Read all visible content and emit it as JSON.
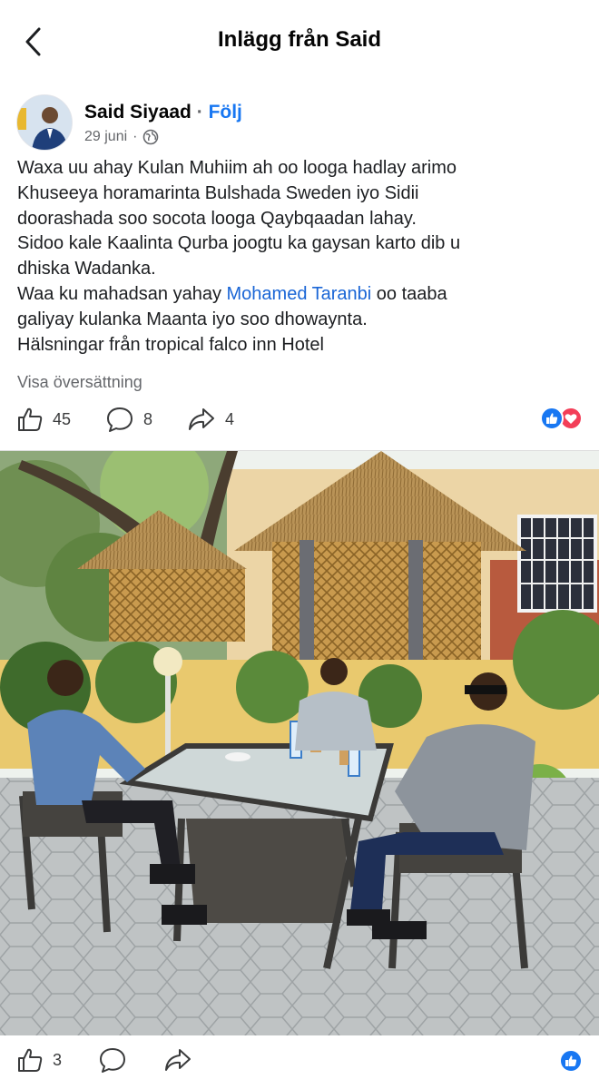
{
  "header": {
    "title": "Inlägg från Said"
  },
  "author": {
    "name": "Said Siyaad",
    "separator": " · ",
    "follow_label": "Följ",
    "date": "29 juni",
    "date_separator": "·"
  },
  "post": {
    "lines": [
      "Waxa uu ahay Kulan Muhiim ah oo looga hadlay arimo",
      "Khuseeya horamarinta Bulshada Sweden iyo Sidii",
      "doorashada soo socota looga Qaybqaadan lahay.",
      "Sidoo kale Kaalinta Qurba joogtu ka gaysan karto dib u",
      "dhiska Wadanka."
    ],
    "line6_before": "Waa ku mahadsan yahay ",
    "mention": "Mohamed Taranbi",
    "line6_after": " oo taaba",
    "lines_end": [
      "galiyay kulanka Maanta iyo soo dhowaynta.",
      "Hälsningar från tropical falco inn Hotel"
    ]
  },
  "translate_label": "Visa översättning",
  "stats": {
    "likes": "45",
    "comments": "8",
    "shares": "4"
  },
  "footer": {
    "likes": "3"
  },
  "colors": {
    "brand_blue": "#1877f2",
    "love_red": "#f33e58",
    "mention_blue": "#1a66d6"
  },
  "icons": [
    "back-arrow-icon",
    "globe-icon",
    "thumbs-up-icon",
    "comment-icon",
    "share-icon",
    "like-reaction-icon",
    "love-reaction-icon"
  ]
}
